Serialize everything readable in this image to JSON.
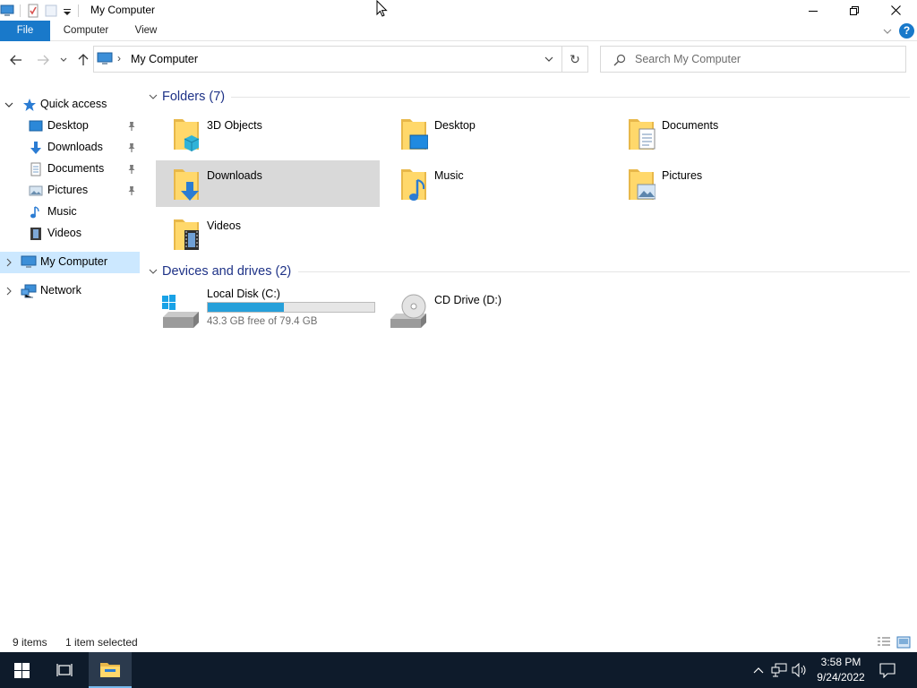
{
  "window": {
    "title": "My Computer"
  },
  "ribbon": {
    "tabs": [
      "File",
      "Computer",
      "View"
    ],
    "help_label": "?"
  },
  "address": {
    "path": "My Computer",
    "refresh_glyph": "↻"
  },
  "search": {
    "placeholder": "Search My Computer"
  },
  "sidebar": {
    "items": [
      {
        "label": "Quick access",
        "icon": "star-icon"
      },
      {
        "label": "Desktop",
        "icon": "desktop-icon",
        "pinned": true
      },
      {
        "label": "Downloads",
        "icon": "download-arrow-icon",
        "pinned": true
      },
      {
        "label": "Documents",
        "icon": "documents-icon",
        "pinned": true
      },
      {
        "label": "Pictures",
        "icon": "pictures-icon",
        "pinned": true
      },
      {
        "label": "Music",
        "icon": "music-note-icon"
      },
      {
        "label": "Videos",
        "icon": "videos-icon"
      },
      {
        "label": "My Computer",
        "icon": "computer-icon",
        "selected": true
      },
      {
        "label": "Network",
        "icon": "network-icon"
      }
    ]
  },
  "folders_group": {
    "title": "Folders (7)",
    "items": [
      {
        "name": "3D Objects",
        "icon": "3d-objects-folder-icon"
      },
      {
        "name": "Desktop",
        "icon": "desktop-folder-icon"
      },
      {
        "name": "Documents",
        "icon": "documents-folder-icon"
      },
      {
        "name": "Downloads",
        "icon": "downloads-folder-icon",
        "selected": true
      },
      {
        "name": "Music",
        "icon": "music-folder-icon"
      },
      {
        "name": "Pictures",
        "icon": "pictures-folder-icon"
      },
      {
        "name": "Videos",
        "icon": "videos-folder-icon"
      }
    ]
  },
  "drives_group": {
    "title": "Devices and drives (2)",
    "items": [
      {
        "name": "Local Disk (C:)",
        "icon": "hard-drive-icon",
        "free_text": "43.3 GB free of 79.4 GB",
        "used_fraction": 0.455
      },
      {
        "name": "CD Drive (D:)",
        "icon": "cd-drive-icon"
      }
    ]
  },
  "status": {
    "items_count": "9 items",
    "selection": "1 item selected"
  },
  "taskbar": {
    "time": "3:58 PM",
    "date": "9/24/2022"
  },
  "colors": {
    "accent": "#1979ca",
    "selection": "#cce8ff",
    "group_title": "#1e3287",
    "taskbar": "#0e1b2b",
    "drive_fill": "#26a0da"
  }
}
